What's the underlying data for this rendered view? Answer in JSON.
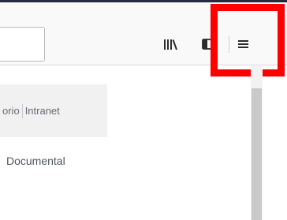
{
  "toolbar": {
    "url_value": "",
    "buttons": [
      {
        "icon": "library-icon"
      },
      {
        "icon": "sidebar-icon"
      },
      {
        "icon": "hamburger-menu-icon"
      }
    ]
  },
  "highlight_color": "#ff0000",
  "page": {
    "nav_items": [
      "orio",
      "Intranet"
    ],
    "doc_link": "Documental"
  }
}
